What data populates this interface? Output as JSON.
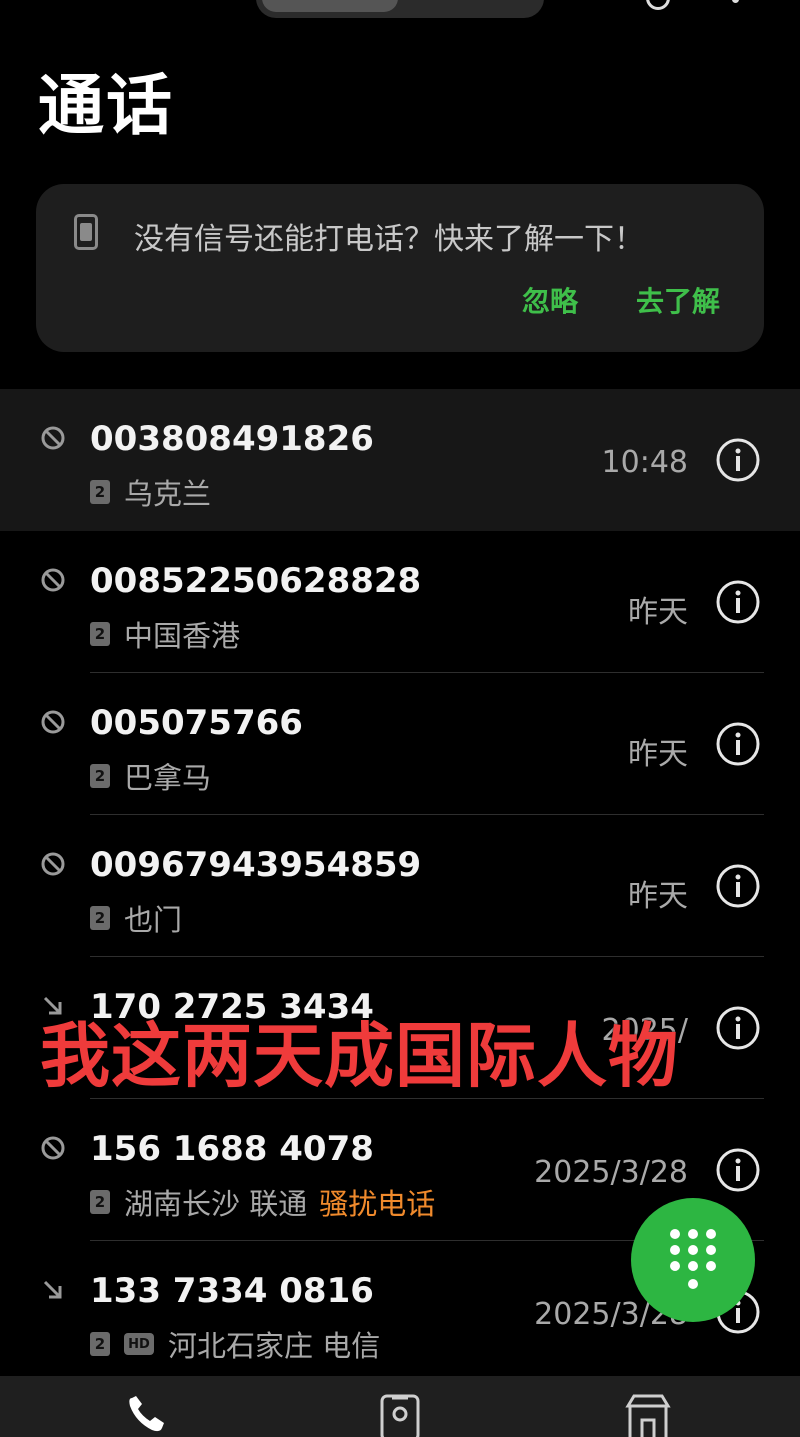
{
  "page": {
    "title": "通话"
  },
  "tip": {
    "text": "没有信号还能打电话？快来了解一下！",
    "ignore_label": "忽略",
    "learn_label": "去了解"
  },
  "calls": [
    {
      "number": "003808491826",
      "sim": "2",
      "location": "乌克兰",
      "time": "10:48",
      "status": "blocked"
    },
    {
      "number": "00852250628828",
      "sim": "2",
      "location": "中国香港",
      "time": "昨天",
      "status": "blocked"
    },
    {
      "number": "005075766",
      "sim": "2",
      "location": "巴拿马",
      "time": "昨天",
      "status": "blocked"
    },
    {
      "number": "00967943954859",
      "sim": "2",
      "location": "也门",
      "time": "昨天",
      "status": "blocked"
    },
    {
      "number": "170 2725 3434",
      "sim": "",
      "location": "",
      "time": "2025/",
      "status": "incoming"
    },
    {
      "number": "156 1688 4078",
      "sim": "2",
      "location": "湖南长沙 联通",
      "tag": "骚扰电话",
      "time": "2025/3/28",
      "status": "blocked"
    },
    {
      "number": "133 7334 0816",
      "sim": "2",
      "hd": "HD",
      "location": "河北石家庄 电信",
      "time": "2025/3/28",
      "status": "incoming"
    }
  ],
  "overlay": {
    "caption": "我这两天成国际人物"
  },
  "icons": {
    "blocked": "block-icon",
    "incoming": "incoming-call-icon",
    "info": "info-icon",
    "dialpad": "dialpad-icon",
    "nav": [
      "phone-icon",
      "contacts-icon",
      "store-icon"
    ]
  },
  "colors": {
    "accent": "#3fbf4a",
    "fab": "#2db642",
    "spam": "#f08a2c",
    "overlay": "#ef3b3b"
  }
}
